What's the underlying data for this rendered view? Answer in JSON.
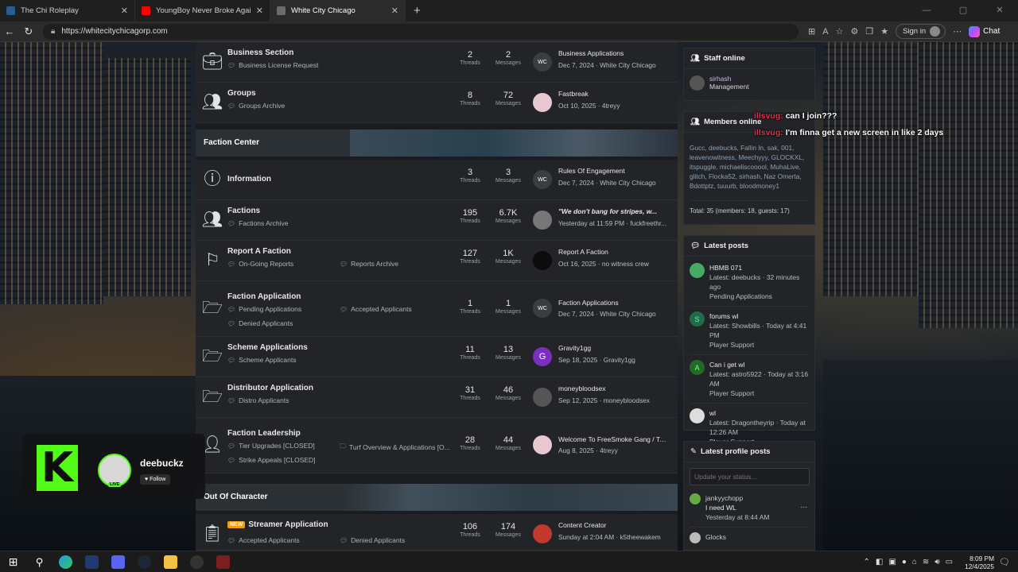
{
  "browser": {
    "tabs": [
      {
        "label": "The Chi Roleplay",
        "color": "#2a5d8f",
        "active": false
      },
      {
        "label": "YoungBoy Never Broke Again",
        "color": "#ff0000",
        "active": false
      },
      {
        "label": "White City Chicago",
        "color": "#6b6b6b",
        "active": true
      }
    ],
    "url": "https://whitecitychicagorp.com",
    "signin_label": "Sign in",
    "chat_label": "Chat"
  },
  "forum": {
    "nodes_top": [
      {
        "title": "Business Section",
        "subs": [
          "Business License Request"
        ],
        "threads": "2",
        "messages": "2",
        "last_title": "Business Applications",
        "last_meta": "Dec 7, 2024 · White City Chicago",
        "av": "WC"
      },
      {
        "title": "Groups",
        "subs": [
          "Groups Archive"
        ],
        "threads": "8",
        "messages": "72",
        "last_title": "Fastbreak",
        "last_meta": "Oct 10, 2025 · 4treyy",
        "av": ""
      }
    ],
    "cat_faction": "Faction Center",
    "nodes_faction": [
      {
        "title": "Information",
        "subs": [],
        "threads": "3",
        "messages": "3",
        "last_title": "Rules Of Engagement",
        "last_meta": "Dec 7, 2024 · White City Chicago",
        "av": "WC"
      },
      {
        "title": "Factions",
        "subs": [
          "Factions Archive"
        ],
        "threads": "195",
        "messages": "6.7K",
        "last_title": "\"We don't bang for stripes, w...",
        "last_meta": "Yesterday at 11:59 PM · fuckfreethr...",
        "av": ""
      },
      {
        "title": "Report A Faction",
        "subs": [
          "On-Going Reports",
          "Reports Archive"
        ],
        "threads": "127",
        "messages": "1K",
        "last_title": "Report A Faction",
        "last_meta": "Oct 16, 2025 · no witness crew",
        "av": ""
      },
      {
        "title": "Faction Application",
        "subs": [
          "Pending Applications",
          "Accepted Applicants",
          "Denied Applicants"
        ],
        "threads": "1",
        "messages": "1",
        "last_title": "Faction Applications",
        "last_meta": "Dec 7, 2024 · White City Chicago",
        "av": "WC"
      },
      {
        "title": "Scheme Applications",
        "subs": [
          "Scheme Applicants"
        ],
        "threads": "11",
        "messages": "13",
        "last_title": "Gravity1gg",
        "last_meta": "Sep 18, 2025 · Gravity1gg",
        "av": "G"
      },
      {
        "title": "Distributor Application",
        "subs": [
          "Distro Applicants"
        ],
        "threads": "31",
        "messages": "46",
        "last_title": "moneybloodsex",
        "last_meta": "Sep 12, 2025 · moneybloodsex",
        "av": ""
      },
      {
        "title": "Faction Leadership",
        "subs": [
          "Tier Upgrades [CLOSED]",
          "Turf Overview & Applications [O...",
          "Strike Appeals [CLOSED]"
        ],
        "threads": "28",
        "messages": "44",
        "last_title": "Welcome To FreeSmoke Gang / Take...",
        "last_meta": "Aug 8, 2025 · 4treyy",
        "av": ""
      }
    ],
    "cat_ooc": "Out Of Character",
    "nodes_ooc": [
      {
        "badge": "NEW",
        "title": "Streamer Application",
        "subs": [
          "Accepted Applicants",
          "Denied Applicants"
        ],
        "threads": "106",
        "messages": "174",
        "last_title": "Content Creator",
        "last_meta": "Sunday at 2:04 AM · k5theewakem",
        "av": ""
      }
    ],
    "threads_label": "Threads",
    "messages_label": "Messages"
  },
  "sidebar": {
    "staff_title": "Staff online",
    "staff_name": "sirhash",
    "staff_role": "Management",
    "members_title": "Members online",
    "members_list": "Gucc, deebucks, Fallin In, sak, 001, leavenowitness, Meechyyy, GLOCKXL, itspuggle, michaeliscooool, MuhaLive, glitch, Flocka52, sirhash, Naz Omerta, Bdottptz, tuuurb, bloodmoney1",
    "members_total": "Total: 35 (members: 18, guests: 17)",
    "latest_posts_title": "Latest posts",
    "latest_posts": [
      {
        "title": "HBMB 071",
        "meta": "Latest: deebucks · 32 minutes ago",
        "forum": "Pending Applications",
        "av": ""
      },
      {
        "title": "forums wl",
        "meta": "Latest: Showbills · Today at 4:41 PM",
        "forum": "Player Support",
        "av": "S"
      },
      {
        "title": "Can i get wl",
        "meta": "Latest: astro5922 · Today at 3:16 AM",
        "forum": "Player Support",
        "av": "A"
      },
      {
        "title": "wl",
        "meta": "Latest: Dragontheyrip · Today at 12:26 AM",
        "forum": "Player Support",
        "av": ""
      }
    ],
    "profile_posts_title": "Latest profile posts",
    "status_placeholder": "Update your status...",
    "profile_posts": [
      {
        "name": "jankyychopp",
        "text": "I need WL",
        "time": "Yesterday at 8:44 AM"
      },
      {
        "name": "Glocks",
        "text": "",
        "time": ""
      }
    ]
  },
  "overlay": {
    "chat": [
      {
        "user": "illsvug:",
        "msg": "can I join???"
      },
      {
        "user": "illsvug:",
        "msg": "I'm finna get a new screen in like 2 days"
      }
    ]
  },
  "kick": {
    "logo": "K",
    "username": "deebuckz",
    "live": "LIVE",
    "follow": "Follow"
  },
  "taskbar": {
    "time": "8:09 PM",
    "date": "12/4/2025"
  }
}
